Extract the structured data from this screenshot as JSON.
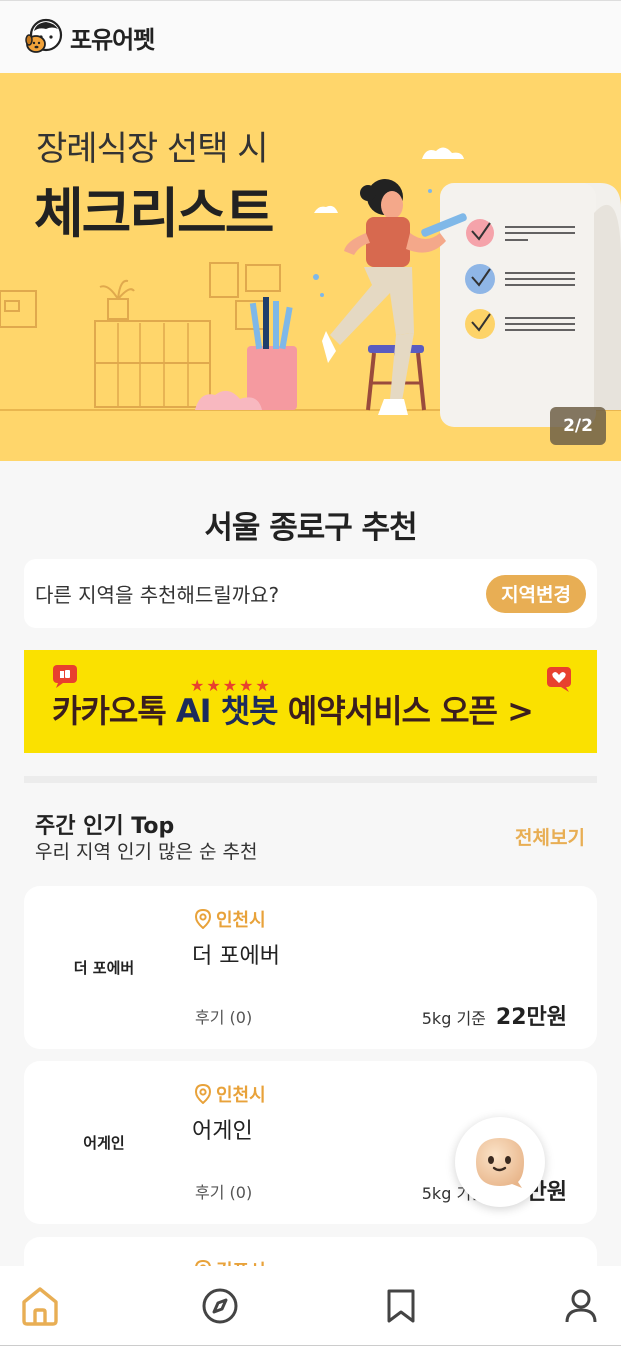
{
  "header": {
    "logo_text": "포유어펫",
    "logo_icon": "pet-face-logo-icon"
  },
  "banner": {
    "subtitle": "장례식장 선택 시",
    "title": "체크리스트",
    "pager": "2/2",
    "colors": {
      "background": "#ffd66b"
    }
  },
  "region": {
    "title": "서울 종로구 추천",
    "question": "다른 지역을 추천해드릴까요?",
    "change_button": "지역변경"
  },
  "kakao_banner": {
    "part1": "카카오톡 ",
    "part2": "AI 챗봇",
    "part3": " 예약서비스 오픈 >",
    "stars": "★★★★★",
    "colors": {
      "background": "#fae100"
    }
  },
  "weekly": {
    "title": "주간 인기 Top",
    "subtitle": "우리 지역 인기 많은 순 추천",
    "see_all": "전체보기"
  },
  "cards": [
    {
      "thumb": "더 포에버",
      "location": "인천시",
      "name": "더 포에버",
      "review": "후기 (0)",
      "basis": "5kg 기준",
      "price": "22만원"
    },
    {
      "thumb": "어게인",
      "location": "인천시",
      "name": "어게인",
      "review": "후기 (0)",
      "basis": "5kg 기준",
      "price": "22만원"
    },
    {
      "thumb": "",
      "location": "김포시",
      "name": "",
      "review": "",
      "basis": "",
      "price": ""
    }
  ],
  "fab": {
    "icon": "chatbot-face-icon"
  },
  "tabbar": {
    "items": [
      {
        "icon": "home-icon",
        "active": true
      },
      {
        "icon": "compass-icon",
        "active": false
      },
      {
        "icon": "bookmark-icon",
        "active": false
      },
      {
        "icon": "profile-icon",
        "active": false
      }
    ],
    "colors": {
      "active": "#e8ae54",
      "inactive": "#444444"
    }
  },
  "colors": {
    "accent": "#e8ae54",
    "page_bg": "#f7f7f7"
  }
}
